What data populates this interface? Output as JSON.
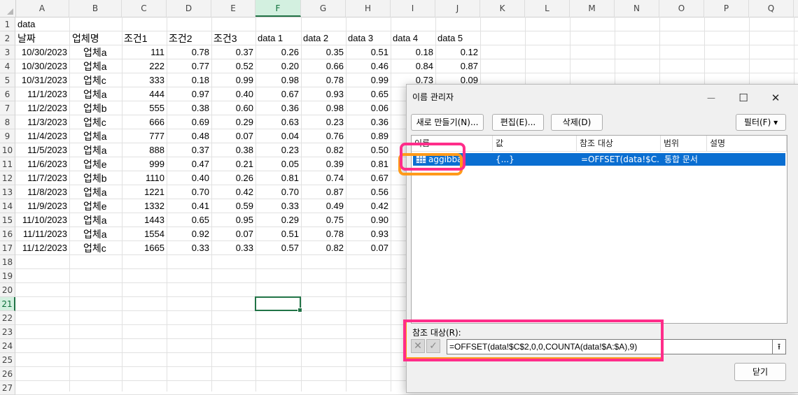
{
  "columns": [
    "A",
    "B",
    "C",
    "D",
    "E",
    "F",
    "G",
    "H",
    "I",
    "J",
    "K",
    "L",
    "M",
    "N",
    "O",
    "P",
    "Q"
  ],
  "rows": [
    "1",
    "2",
    "3",
    "4",
    "5",
    "6",
    "7",
    "8",
    "9",
    "10",
    "11",
    "12",
    "13",
    "14",
    "15",
    "16",
    "17",
    "18",
    "19",
    "20",
    "21",
    "22",
    "23",
    "24",
    "25",
    "26",
    "27"
  ],
  "title_cell": "data",
  "headers": [
    "날짜",
    "업체명",
    "조건1",
    "조건2",
    "조건3",
    "data 1",
    "data 2",
    "data 3",
    "data 4",
    "data 5"
  ],
  "data_rows": [
    [
      "10/30/2023",
      "업체a",
      "111",
      "0.78",
      "0.37",
      "0.26",
      "0.35",
      "0.51",
      "0.18",
      "0.12"
    ],
    [
      "10/30/2023",
      "업체a",
      "222",
      "0.77",
      "0.52",
      "0.20",
      "0.66",
      "0.46",
      "0.84",
      "0.87"
    ],
    [
      "10/31/2023",
      "업체c",
      "333",
      "0.18",
      "0.99",
      "0.98",
      "0.78",
      "0.99",
      "0.73",
      "0.09"
    ],
    [
      "11/1/2023",
      "업체a",
      "444",
      "0.97",
      "0.40",
      "0.67",
      "0.93",
      "0.65",
      "",
      ""
    ],
    [
      "11/2/2023",
      "업체b",
      "555",
      "0.38",
      "0.60",
      "0.36",
      "0.98",
      "0.06",
      "",
      ""
    ],
    [
      "11/3/2023",
      "업체c",
      "666",
      "0.69",
      "0.29",
      "0.63",
      "0.23",
      "0.36",
      "",
      ""
    ],
    [
      "11/4/2023",
      "업체a",
      "777",
      "0.48",
      "0.07",
      "0.04",
      "0.76",
      "0.89",
      "",
      ""
    ],
    [
      "11/5/2023",
      "업체a",
      "888",
      "0.37",
      "0.38",
      "0.23",
      "0.82",
      "0.50",
      "",
      ""
    ],
    [
      "11/6/2023",
      "업체e",
      "999",
      "0.47",
      "0.21",
      "0.05",
      "0.39",
      "0.81",
      "",
      ""
    ],
    [
      "11/7/2023",
      "업체b",
      "1110",
      "0.40",
      "0.26",
      "0.81",
      "0.74",
      "0.67",
      "",
      ""
    ],
    [
      "11/8/2023",
      "업체a",
      "1221",
      "0.70",
      "0.42",
      "0.70",
      "0.87",
      "0.56",
      "",
      ""
    ],
    [
      "11/9/2023",
      "업체e",
      "1332",
      "0.41",
      "0.59",
      "0.33",
      "0.49",
      "0.42",
      "",
      ""
    ],
    [
      "11/10/2023",
      "업체a",
      "1443",
      "0.65",
      "0.95",
      "0.29",
      "0.75",
      "0.90",
      "",
      ""
    ],
    [
      "11/11/2023",
      "업체a",
      "1554",
      "0.92",
      "0.07",
      "0.51",
      "0.78",
      "0.93",
      "",
      ""
    ],
    [
      "11/12/2023",
      "업체c",
      "1665",
      "0.33",
      "0.33",
      "0.57",
      "0.82",
      "0.07",
      "",
      ""
    ]
  ],
  "active_cell": {
    "column": "F",
    "row": "21"
  },
  "dialog": {
    "title": "이름 관리자",
    "minimize": "—",
    "maximize": "☐",
    "close": "✕",
    "new_button": "새로 만들기(N)...",
    "edit_button": "편집(E)...",
    "delete_button": "삭제(D)",
    "filter_button": "필터(F) ▾",
    "list_headers": [
      "이름",
      "값",
      "참조 대상",
      "범위",
      "설명"
    ],
    "names": [
      {
        "name": "aggibba",
        "value": "{...}",
        "refers_to": "=OFFSET(data!$C...",
        "scope": "통합 문서",
        "comment": ""
      }
    ],
    "refers_to_label": "참조 대상(R):",
    "refers_to_value": "=OFFSET(data!$C$2,0,0,COUNTA(data!$A:$A),9)",
    "cancel_icon": "✕",
    "confirm_icon": "✓",
    "collapse_icon": "⭱",
    "close_button": "닫기"
  },
  "colors": {
    "selection": "#0a6ed1",
    "excel_green": "#217346",
    "highlight_pink": "#ff2d8a",
    "highlight_orange": "#ff9a1a"
  }
}
